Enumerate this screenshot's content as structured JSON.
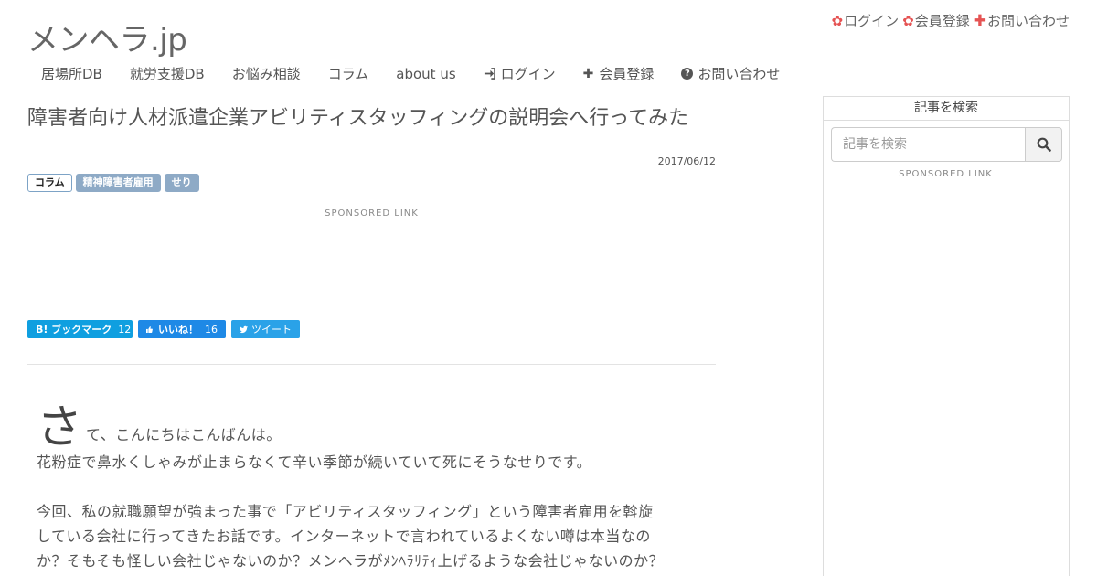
{
  "site": {
    "logo": "メンヘラ.jp"
  },
  "top_links": {
    "login": "ログイン",
    "register": "会員登録",
    "contact": "お問い合わせ"
  },
  "nav": {
    "items": [
      "居場所DB",
      "就労支援DB",
      "お悩み相談",
      "コラム",
      "about us"
    ],
    "login": "ログイン",
    "register": "会員登録",
    "contact": "お問い合わせ"
  },
  "article": {
    "title": "障害者向け人材派遣企業アビリティスタッフィングの説明会へ行ってみた",
    "date": "2017/06/12",
    "tags": [
      "コラム",
      "精神障害者雇用",
      "せり"
    ],
    "sponsored": "SPONSORED LINK",
    "dropcap": "さ",
    "first_line_rest": "て、こんにちはこんばんは。",
    "para1": "花粉症で鼻水くしゃみが止まらなくて辛い季節が続いていて死にそうなせりです。",
    "para2_line1": "今回、私の就職願望が強まった事で「アビリティスタッフィング」という障害者雇用を斡旋",
    "para2_line2": "している会社に行ってきたお話です。インターネットで言われているよくない噂は本当なの",
    "para2_line3": "か？そもそも怪しい会社じゃないのか？メンヘラがﾒﾝﾍﾗﾘﾃｨ上げるような会社じゃないのか？"
  },
  "share": {
    "hatena_label": "B! ブックマーク",
    "hatena_count": "12",
    "fb_label": "いいね！",
    "fb_count": "16",
    "tw_label": "ツイート"
  },
  "sidebar": {
    "title": "記事を検索",
    "search_placeholder": "記事を検索",
    "sponsored": "SPONSORED LINK"
  },
  "colors": {
    "accent_red": "#e55353",
    "hatena_blue": "#0f9fe0",
    "facebook_blue": "#1e89e6",
    "twitter_blue": "#2aa2e8",
    "tag_blue": "#8eaac6"
  }
}
